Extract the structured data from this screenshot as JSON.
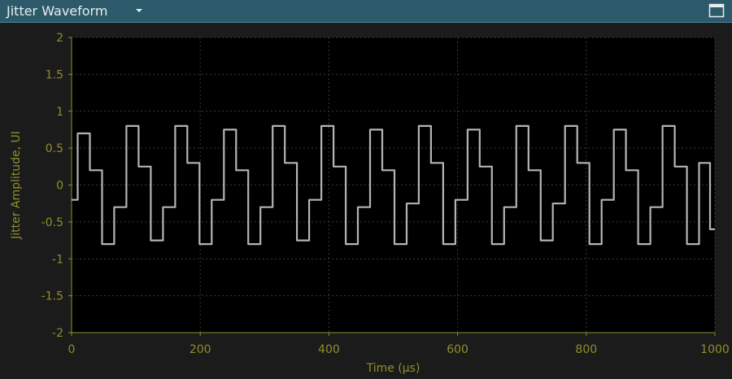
{
  "window": {
    "title": "Jitter Waveform",
    "dropdown_icon": "chevron-down-icon",
    "maximize_icon": "maximize-icon"
  },
  "chart_data": {
    "type": "line",
    "xlabel": "Time (µs)",
    "ylabel": "Jitter Amplitude, UI",
    "xlim": [
      0,
      1000
    ],
    "ylim": [
      -2,
      2
    ],
    "xticks": [
      0,
      200,
      400,
      600,
      800,
      1000
    ],
    "yticks": [
      2,
      1.5,
      1,
      0.5,
      0,
      -0.5,
      -1,
      -1.5,
      -2
    ],
    "grid": true,
    "background": "#000000",
    "line_color": "#c8c8c8",
    "axis_color": "#8f8f2a",
    "series": [
      {
        "points_per_cycle": 8,
        "x": [
          0,
          18.9,
          37.9,
          56.8,
          75.8,
          94.7,
          113.6,
          132.6,
          151.5,
          170.5,
          189.4,
          208.3,
          227.3,
          246.2,
          265.2,
          284.1,
          303.0,
          322.0,
          340.9,
          359.8,
          378.8,
          397.7,
          416.7,
          435.6,
          454.5,
          473.5,
          492.4,
          511.4,
          530.3,
          549.2,
          568.2,
          587.1,
          606.1,
          625.0,
          643.9,
          662.9,
          681.8,
          700.8,
          719.7,
          738.6,
          757.6,
          776.5,
          795.5,
          814.4,
          833.3,
          852.3,
          871.2,
          890.2,
          909.1,
          928.0,
          947.0,
          965.9,
          984.8,
          1000
        ],
        "y": [
          -0.2,
          0.7,
          0.2,
          -0.8,
          -0.3,
          0.8,
          0.25,
          -0.75,
          -0.3,
          0.8,
          0.3,
          -0.8,
          -0.2,
          0.75,
          0.2,
          -0.8,
          -0.3,
          0.8,
          0.3,
          -0.75,
          -0.2,
          0.8,
          0.25,
          -0.8,
          -0.3,
          0.75,
          0.2,
          -0.8,
          -0.25,
          0.8,
          0.3,
          -0.8,
          -0.2,
          0.75,
          0.25,
          -0.8,
          -0.3,
          0.8,
          0.2,
          -0.75,
          -0.25,
          0.8,
          0.3,
          -0.8,
          -0.2,
          0.75,
          0.2,
          -0.8,
          -0.3,
          0.8,
          0.25,
          -0.8,
          0.3,
          -0.6
        ]
      }
    ]
  }
}
